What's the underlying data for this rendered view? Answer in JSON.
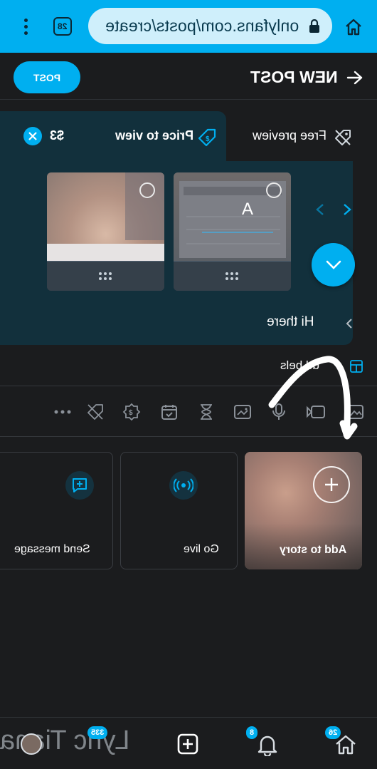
{
  "browser": {
    "url": "onlyfans.com/posts/create",
    "tab_count": "28"
  },
  "header": {
    "title": "NEW POST",
    "post_button": "POST"
  },
  "tabs": {
    "free_preview": "Free preview",
    "price_to_view": "Price to view",
    "price": "$3"
  },
  "thumb_overlay_text": "A",
  "caption": "Hi there",
  "labels_text": "dd  bels",
  "actions": {
    "add_to_story": "Add to story",
    "go_live": "Go live",
    "send_message": "Send message"
  },
  "bottom": {
    "home_badge": "26",
    "notif_badge": "8",
    "messages_badge": "335",
    "watermark": "Lyric Tiana"
  },
  "colors": {
    "accent": "#00aff0",
    "background": "#1b1c1e",
    "panel": "#12303c"
  }
}
